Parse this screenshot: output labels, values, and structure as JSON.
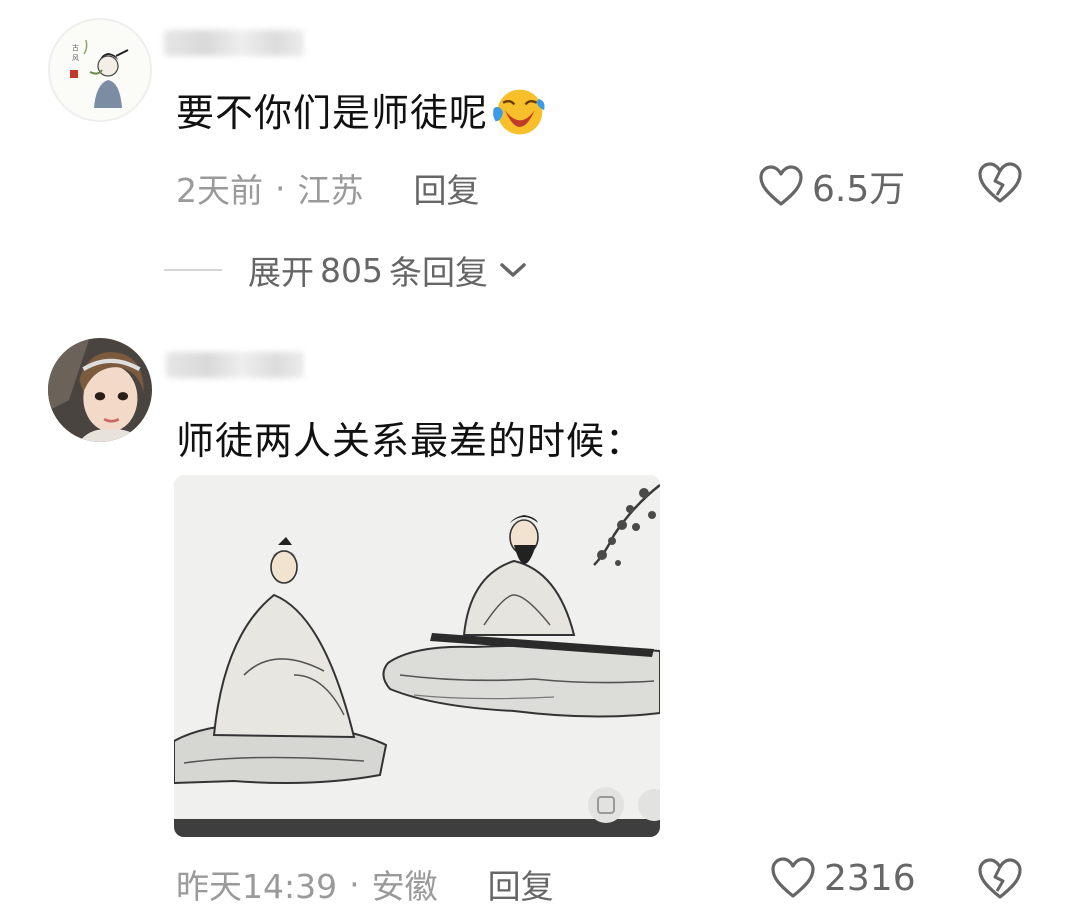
{
  "comments": [
    {
      "author": "",
      "text": "要不你们是师徒呢",
      "emoji": "laughing-crying-emoji",
      "time": "2天前",
      "location": "江苏",
      "separator": "·",
      "reply_label": "回复",
      "likes": "6.5万",
      "expand": {
        "prefix": "展开",
        "count": "805",
        "suffix": "条回复"
      }
    },
    {
      "author": "",
      "text": "师徒两人关系最差的时候：",
      "image": "ink-painting-master-disciple",
      "time": "昨天14:39",
      "location": "安徽",
      "separator": "·",
      "reply_label": "回复",
      "likes": "2316"
    }
  ],
  "colors": {
    "text": "#111111",
    "meta": "#9a9a9a",
    "action": "#666666",
    "background": "#ffffff"
  }
}
